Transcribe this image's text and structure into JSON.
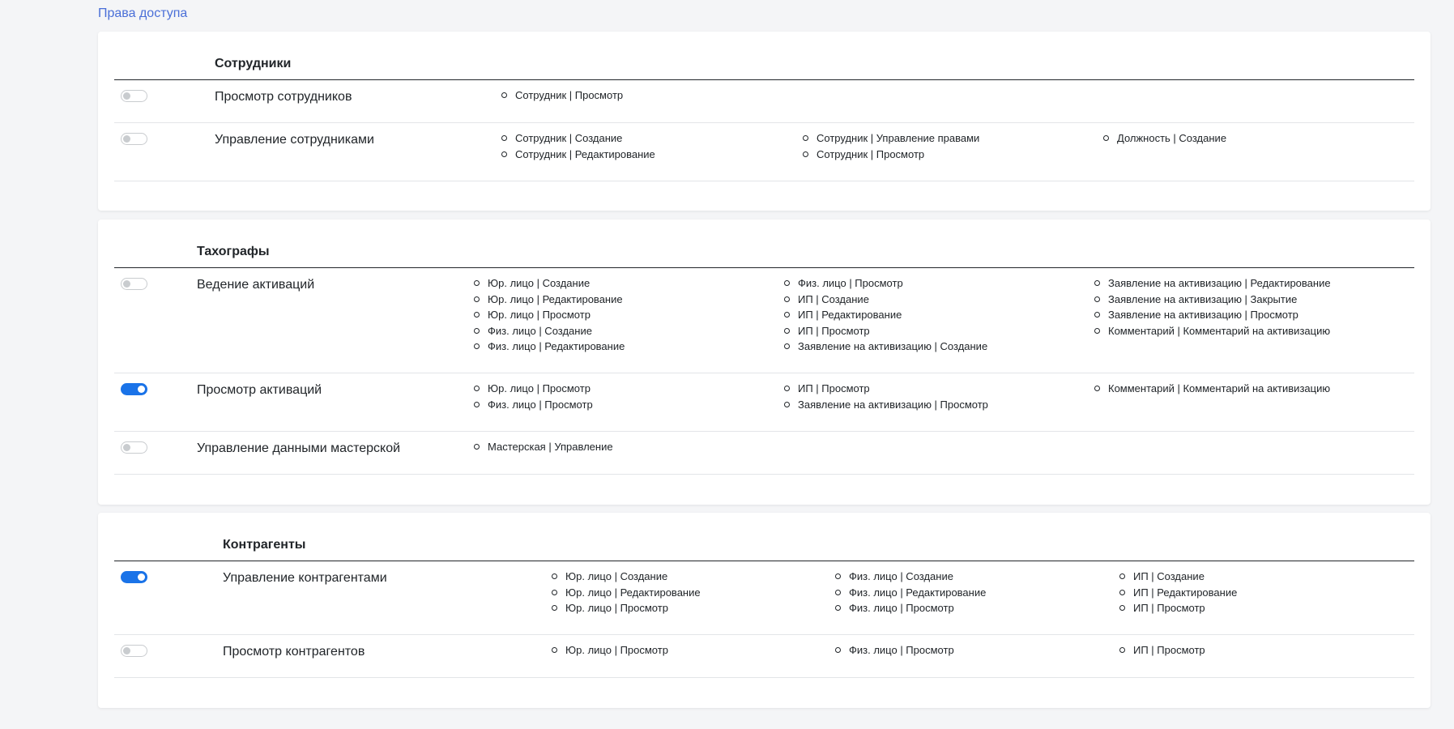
{
  "page_link": "Права доступа",
  "accent_color": "#1a73e8",
  "sections": [
    {
      "title": "Сотрудники",
      "rows": [
        {
          "label": "Просмотр сотрудников",
          "enabled": false,
          "columns": [
            [
              "Сотрудник | Просмотр"
            ]
          ]
        },
        {
          "label": "Управление сотрудниками",
          "enabled": false,
          "columns": [
            [
              "Сотрудник | Создание",
              "Сотрудник | Редактирование"
            ],
            [
              "Сотрудник | Управление правами",
              "Сотрудник | Просмотр"
            ],
            [
              "Должность | Создание"
            ]
          ]
        }
      ]
    },
    {
      "title": "Тахографы",
      "rows": [
        {
          "label": "Ведение активаций",
          "enabled": false,
          "columns": [
            [
              "Юр. лицо | Создание",
              "Юр. лицо | Редактирование",
              "Юр. лицо | Просмотр",
              "Физ. лицо | Создание",
              "Физ. лицо | Редактирование"
            ],
            [
              "Физ. лицо | Просмотр",
              "ИП | Создание",
              "ИП | Редактирование",
              "ИП | Просмотр",
              "Заявление на активизацию | Создание"
            ],
            [
              "Заявление на активизацию | Редактирование",
              "Заявление на активизацию | Закрытие",
              "Заявление на активизацию | Просмотр",
              "Комментарий | Комментарий на активизацию"
            ]
          ]
        },
        {
          "label": "Просмотр активаций",
          "enabled": true,
          "columns": [
            [
              "Юр. лицо | Просмотр",
              "Физ. лицо | Просмотр"
            ],
            [
              "ИП | Просмотр",
              "Заявление на активизацию | Просмотр"
            ],
            [
              "Комментарий | Комментарий на активизацию"
            ]
          ]
        },
        {
          "label": "Управление данными мастерской",
          "enabled": false,
          "columns": [
            [
              "Мастерская | Управление"
            ]
          ]
        }
      ]
    },
    {
      "title": "Контрагенты",
      "rows": [
        {
          "label": "Управление контрагентами",
          "enabled": true,
          "columns": [
            [
              "Юр. лицо | Создание",
              "Юр. лицо | Редактирование",
              "Юр. лицо | Просмотр"
            ],
            [
              "Физ. лицо | Создание",
              "Физ. лицо | Редактирование",
              "Физ. лицо | Просмотр"
            ],
            [
              "ИП | Создание",
              "ИП | Редактирование",
              "ИП | Просмотр"
            ]
          ]
        },
        {
          "label": "Просмотр контрагентов",
          "enabled": false,
          "columns": [
            [
              "Юр. лицо | Просмотр"
            ],
            [
              "Физ. лицо | Просмотр"
            ],
            [
              "ИП | Просмотр"
            ]
          ]
        }
      ]
    }
  ]
}
